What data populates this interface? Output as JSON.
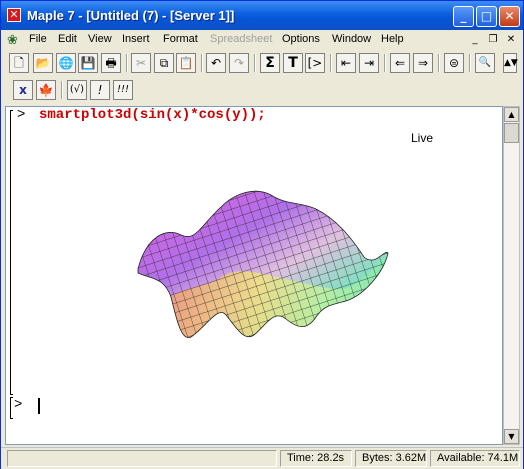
{
  "window": {
    "title": "Maple 7  - [Untitled (7) - [Server 1]]",
    "icon": "maple-leaf-icon",
    "controls": [
      "minimize-icon",
      "maximize-icon",
      "close-icon"
    ]
  },
  "menubar": {
    "items": [
      {
        "label": "File",
        "enabled": true
      },
      {
        "label": "Edit",
        "enabled": true
      },
      {
        "label": "View",
        "enabled": true
      },
      {
        "label": "Insert",
        "enabled": true
      },
      {
        "label": "Format",
        "enabled": true
      },
      {
        "label": "Spreadsheet",
        "enabled": false
      },
      {
        "label": "Options",
        "enabled": true
      },
      {
        "label": "Window",
        "enabled": true
      },
      {
        "label": "Help",
        "enabled": true
      }
    ]
  },
  "toolbar1": {
    "buttons": [
      {
        "icon": "new-document-icon",
        "glyph": "🗋"
      },
      {
        "icon": "open-folder-icon",
        "glyph": "📂"
      },
      {
        "icon": "open-url-icon",
        "glyph": "🌐"
      },
      {
        "icon": "save-icon",
        "glyph": "💾"
      },
      {
        "icon": "print-icon",
        "glyph": "🖶"
      },
      {
        "icon": "cut-icon",
        "glyph": "✂",
        "enabled": false
      },
      {
        "icon": "copy-icon",
        "glyph": "⧉"
      },
      {
        "icon": "paste-icon",
        "glyph": "📋"
      },
      {
        "icon": "undo-icon",
        "glyph": "↶"
      },
      {
        "icon": "redo-icon",
        "glyph": "↷",
        "enabled": false
      },
      {
        "icon": "math-mode-icon",
        "glyph": "Σ"
      },
      {
        "icon": "text-mode-icon",
        "glyph": "T"
      },
      {
        "icon": "insert-prompt-icon",
        "glyph": "[>"
      },
      {
        "icon": "outdent-icon",
        "glyph": "⇤"
      },
      {
        "icon": "indent-icon",
        "glyph": "⇥"
      },
      {
        "icon": "back-icon",
        "glyph": "⇐"
      },
      {
        "icon": "forward-icon",
        "glyph": "⇒"
      },
      {
        "icon": "stop-icon",
        "glyph": "⊜"
      },
      {
        "icon": "zoom-icon",
        "glyph": "🔍"
      }
    ]
  },
  "toolbar2": {
    "buttons": [
      {
        "icon": "interrupt-icon",
        "glyph": "x"
      },
      {
        "icon": "maple-restart-icon",
        "glyph": "🍁"
      },
      {
        "icon": "execute-all-icon",
        "glyph": "(√)"
      },
      {
        "icon": "execute-icon",
        "glyph": "!"
      },
      {
        "icon": "execute-worksheet-icon",
        "glyph": "!!!"
      }
    ]
  },
  "worksheet": {
    "prompt1": ">",
    "command": "smartplot3d(sin(x)*cos(y));",
    "plot_label": "Live",
    "prompt2": ">"
  },
  "statusbar": {
    "time": "Time:  28.2s",
    "bytes": "Bytes: 3.62M",
    "available": "Available: 74.1M"
  }
}
